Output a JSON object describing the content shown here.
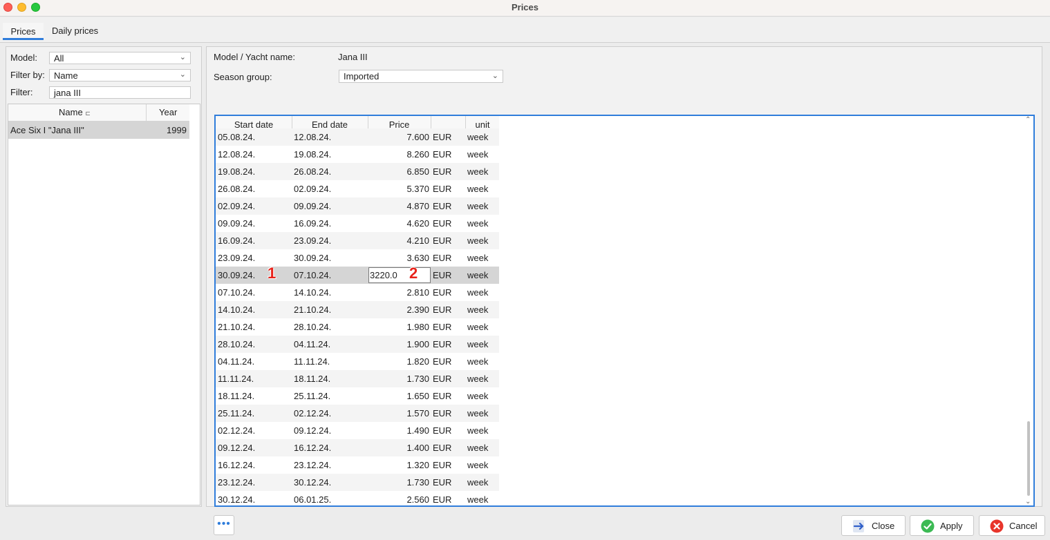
{
  "window": {
    "title": "Prices"
  },
  "tabs": [
    {
      "label": "Prices",
      "active": true
    },
    {
      "label": "Daily prices",
      "active": false
    }
  ],
  "filters": {
    "model_label": "Model:",
    "model_value": "All",
    "filterby_label": "Filter by:",
    "filterby_value": "Name",
    "filter_label": "Filter:",
    "filter_value": "jana III"
  },
  "yacht_table": {
    "columns": [
      "Name",
      "Year"
    ],
    "sort_indicator": "⊏",
    "rows": [
      {
        "name": "Ace Six I \"Jana III\"",
        "year": "1999"
      }
    ]
  },
  "details": {
    "name_label": "Model / Yacht name:",
    "name_value": "Jana III",
    "season_label": "Season group:",
    "season_value": "Imported"
  },
  "price_table": {
    "columns": {
      "start": "Start date",
      "end": "End date",
      "price": "Price",
      "currency": "",
      "unit": "unit"
    },
    "rows": [
      {
        "start": "05.08.24.",
        "end": "12.08.24.",
        "price": "7.600",
        "currency": "EUR",
        "unit": "week"
      },
      {
        "start": "12.08.24.",
        "end": "19.08.24.",
        "price": "8.260",
        "currency": "EUR",
        "unit": "week"
      },
      {
        "start": "19.08.24.",
        "end": "26.08.24.",
        "price": "6.850",
        "currency": "EUR",
        "unit": "week"
      },
      {
        "start": "26.08.24.",
        "end": "02.09.24.",
        "price": "5.370",
        "currency": "EUR",
        "unit": "week"
      },
      {
        "start": "02.09.24.",
        "end": "09.09.24.",
        "price": "4.870",
        "currency": "EUR",
        "unit": "week"
      },
      {
        "start": "09.09.24.",
        "end": "16.09.24.",
        "price": "4.620",
        "currency": "EUR",
        "unit": "week"
      },
      {
        "start": "16.09.24.",
        "end": "23.09.24.",
        "price": "4.210",
        "currency": "EUR",
        "unit": "week"
      },
      {
        "start": "23.09.24.",
        "end": "30.09.24.",
        "price": "3.630",
        "currency": "EUR",
        "unit": "week"
      },
      {
        "start": "30.09.24.",
        "end": "07.10.24.",
        "price": "",
        "edit_value": "3220.0",
        "currency": "EUR",
        "unit": "week",
        "selected": true
      },
      {
        "start": "07.10.24.",
        "end": "14.10.24.",
        "price": "2.810",
        "currency": "EUR",
        "unit": "week"
      },
      {
        "start": "14.10.24.",
        "end": "21.10.24.",
        "price": "2.390",
        "currency": "EUR",
        "unit": "week"
      },
      {
        "start": "21.10.24.",
        "end": "28.10.24.",
        "price": "1.980",
        "currency": "EUR",
        "unit": "week"
      },
      {
        "start": "28.10.24.",
        "end": "04.11.24.",
        "price": "1.900",
        "currency": "EUR",
        "unit": "week"
      },
      {
        "start": "04.11.24.",
        "end": "11.11.24.",
        "price": "1.820",
        "currency": "EUR",
        "unit": "week"
      },
      {
        "start": "11.11.24.",
        "end": "18.11.24.",
        "price": "1.730",
        "currency": "EUR",
        "unit": "week"
      },
      {
        "start": "18.11.24.",
        "end": "25.11.24.",
        "price": "1.650",
        "currency": "EUR",
        "unit": "week"
      },
      {
        "start": "25.11.24.",
        "end": "02.12.24.",
        "price": "1.570",
        "currency": "EUR",
        "unit": "week"
      },
      {
        "start": "02.12.24.",
        "end": "09.12.24.",
        "price": "1.490",
        "currency": "EUR",
        "unit": "week"
      },
      {
        "start": "09.12.24.",
        "end": "16.12.24.",
        "price": "1.400",
        "currency": "EUR",
        "unit": "week"
      },
      {
        "start": "16.12.24.",
        "end": "23.12.24.",
        "price": "1.320",
        "currency": "EUR",
        "unit": "week"
      },
      {
        "start": "23.12.24.",
        "end": "30.12.24.",
        "price": "1.730",
        "currency": "EUR",
        "unit": "week"
      },
      {
        "start": "30.12.24.",
        "end": "06.01.25.",
        "price": "2.560",
        "currency": "EUR",
        "unit": "week"
      }
    ]
  },
  "annotations": {
    "marker1": "1",
    "marker2": "2"
  },
  "footer": {
    "more_label": "•••",
    "close_label": "Close",
    "apply_label": "Apply",
    "cancel_label": "Cancel"
  },
  "icons": {
    "close": "arrow-right-icon",
    "apply": "check-circle-icon",
    "cancel": "x-circle-icon"
  },
  "colors": {
    "accent": "#2f7ddb",
    "annotation": "#e8231b",
    "apply_green": "#3cba54",
    "cancel_red": "#e8352b"
  }
}
